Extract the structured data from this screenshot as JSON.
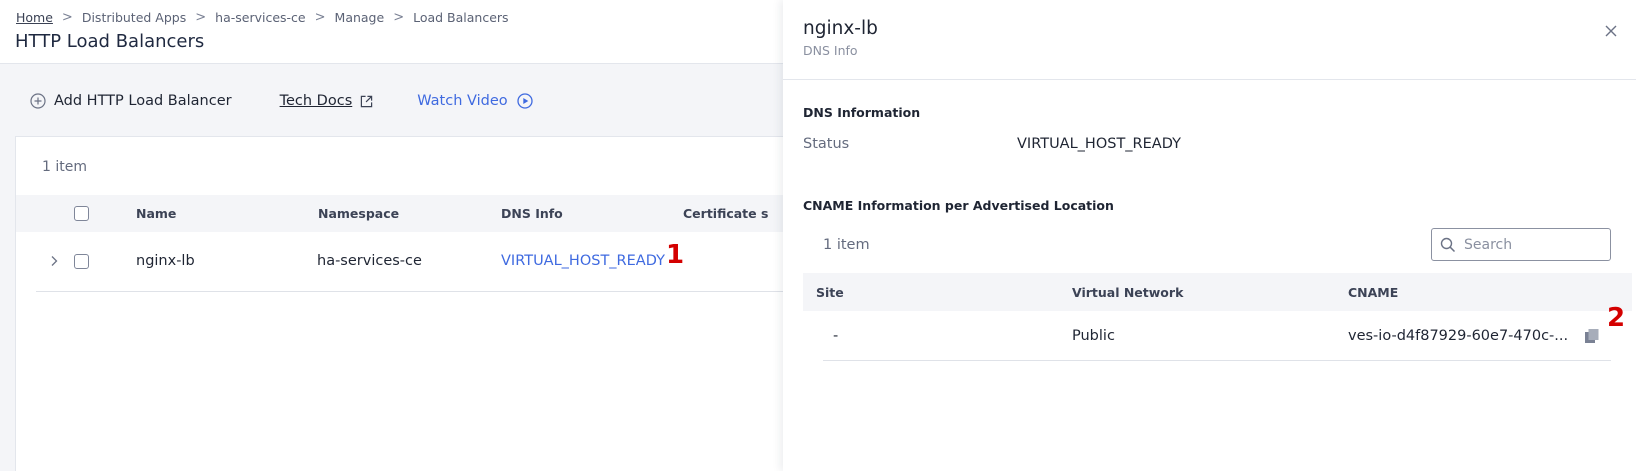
{
  "breadcrumb": {
    "items": [
      "Home",
      "Distributed Apps",
      "ha-services-ce",
      "Manage",
      "Load Balancers"
    ],
    "separator": ">"
  },
  "page": {
    "title": "HTTP Load Balancers"
  },
  "toolbar": {
    "add_label": "Add HTTP Load Balancer",
    "docs_label": "Tech Docs",
    "video_label": "Watch Video"
  },
  "table": {
    "item_count": "1 item",
    "columns": [
      "Name",
      "Namespace",
      "DNS Info",
      "Certificate s"
    ],
    "rows": [
      {
        "name": "nginx-lb",
        "namespace": "ha-services-ce",
        "dns_info": "VIRTUAL_HOST_READY"
      }
    ]
  },
  "markers": {
    "one": "1",
    "two": "2"
  },
  "drawer": {
    "title": "nginx-lb",
    "subtitle": "DNS Info",
    "dns_section_title": "DNS Information",
    "status_label": "Status",
    "status_value": "VIRTUAL_HOST_READY",
    "cname_section_title": "CNAME Information per Advertised Location",
    "item_count": "1 item",
    "search_placeholder": "Search",
    "columns": [
      "Site",
      "Virtual Network",
      "CNAME"
    ],
    "rows": [
      {
        "site": "-",
        "virtual_network": "Public",
        "cname": "ves-io-d4f87929-60e7-470c-..."
      }
    ]
  },
  "colors": {
    "accent": "#3f6ae0",
    "marker": "#d40000",
    "header_bg": "#f4f5f8"
  },
  "icons": [
    "chevron-right-icon",
    "plus-circle-icon",
    "external-link-icon",
    "play-circle-icon",
    "close-icon",
    "search-icon",
    "copy-icon"
  ]
}
